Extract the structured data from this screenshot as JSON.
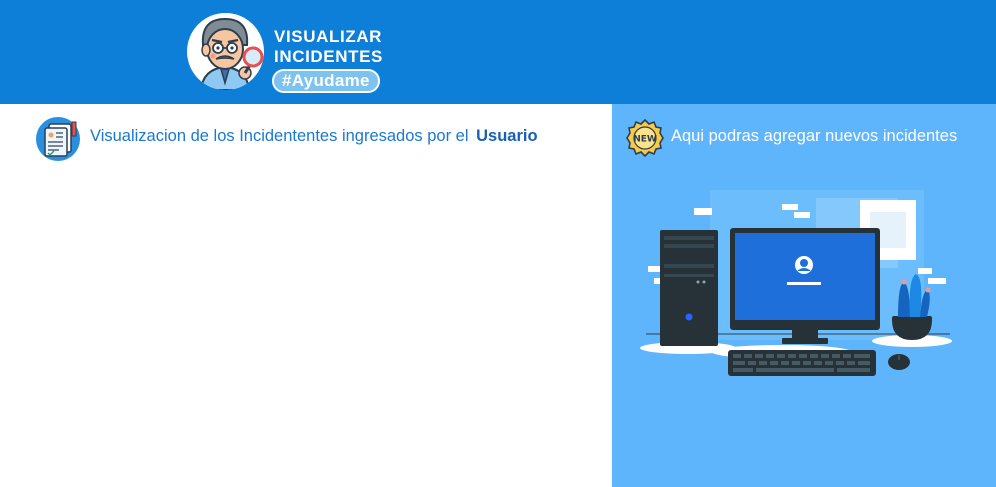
{
  "header": {
    "title_line1": "VISUALIZAR",
    "title_line2": "INCIDENTES",
    "hashtag": "#Ayudame",
    "background_color": "#0d7fd9",
    "logo_icon": "inspector-avatar-icon"
  },
  "list_section": {
    "text": "Visualizacion de los Incidententes ingresados por el",
    "highlight": "Usuario",
    "icon": "document-report-icon",
    "items": []
  },
  "new_incident_panel": {
    "text": "Aqui podras agregar nuevos incidentes",
    "badge_icon": "new-badge-icon",
    "illustration": "computer-setup-illustration",
    "background_color": "#5eb5fb"
  }
}
